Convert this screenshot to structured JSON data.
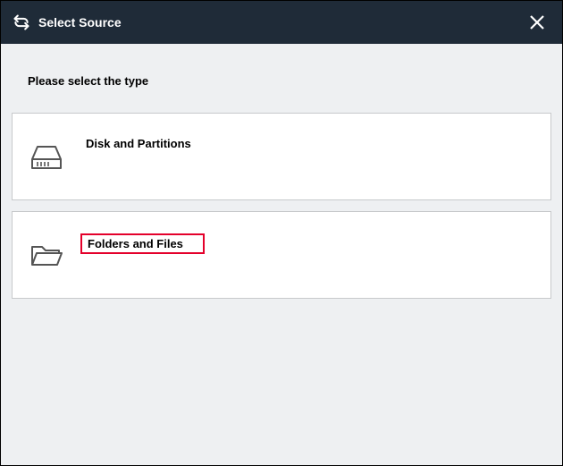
{
  "header": {
    "title": "Select Source"
  },
  "main": {
    "prompt": "Please select the type",
    "options": [
      {
        "label": "Disk and Partitions"
      },
      {
        "label": "Folders and Files"
      }
    ]
  }
}
